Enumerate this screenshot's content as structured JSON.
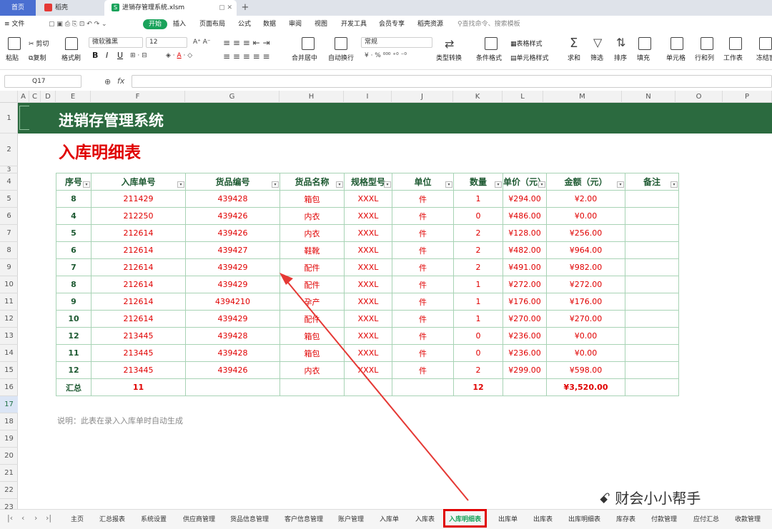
{
  "window": {
    "tabs": [
      {
        "label": "首页"
      },
      {
        "label": "稻壳"
      },
      {
        "label": "进销存管理系统.xlsm"
      }
    ]
  },
  "menu": {
    "file": "文件",
    "items": [
      "开始",
      "插入",
      "页面布局",
      "公式",
      "数据",
      "审阅",
      "视图",
      "开发工具",
      "会员专享",
      "稻壳资源"
    ],
    "search_placeholder": "查找命令、搜索模板"
  },
  "ribbon": {
    "paste": "粘贴",
    "cut": "剪切",
    "copy": "复制",
    "format_painter": "格式刷",
    "font_name": "微软雅黑",
    "font_size": "12",
    "merge": "合并居中",
    "wrap": "自动换行",
    "number_format": "常规",
    "type_convert": "类型转换",
    "cond_format": "条件格式",
    "table_style": "表格样式",
    "cell_style": "单元格样式",
    "sum": "求和",
    "filter": "筛选",
    "sort": "排序",
    "fill": "填充",
    "cell": "单元格",
    "row_col": "行和列",
    "worksheet": "工作表",
    "freeze": "冻结窗"
  },
  "formula_bar": {
    "cell_ref": "Q17",
    "fx": "fx",
    "value": ""
  },
  "columns": [
    "A",
    "C",
    "D",
    "E",
    "F",
    "G",
    "H",
    "I",
    "J",
    "K",
    "L",
    "M",
    "N",
    "O",
    "P"
  ],
  "rows": [
    "1",
    "2",
    "3",
    "4",
    "5",
    "6",
    "7",
    "8",
    "9",
    "10",
    "11",
    "12",
    "13",
    "14",
    "15",
    "16",
    "17",
    "18",
    "19",
    "20",
    "21",
    "22",
    "23"
  ],
  "active_row": "17",
  "sheet": {
    "banner_title": "进销存管理系统",
    "subtitle": "入库明细表",
    "headers": [
      "序号",
      "入库单号",
      "货品编号",
      "货品名称",
      "规格型号",
      "单位",
      "数量",
      "单价（元）",
      "金额（元）",
      "备注"
    ],
    "rows": [
      [
        "8",
        "211429",
        "439428",
        "箱包",
        "XXXL",
        "件",
        "1",
        "¥294.00",
        "¥2.00",
        ""
      ],
      [
        "4",
        "212250",
        "439426",
        "内衣",
        "XXXL",
        "件",
        "0",
        "¥486.00",
        "¥0.00",
        ""
      ],
      [
        "5",
        "212614",
        "439426",
        "内衣",
        "XXXL",
        "件",
        "2",
        "¥128.00",
        "¥256.00",
        ""
      ],
      [
        "6",
        "212614",
        "439427",
        "鞋靴",
        "XXXL",
        "件",
        "2",
        "¥482.00",
        "¥964.00",
        ""
      ],
      [
        "7",
        "212614",
        "439429",
        "配件",
        "XXXL",
        "件",
        "2",
        "¥491.00",
        "¥982.00",
        ""
      ],
      [
        "8",
        "212614",
        "439429",
        "配件",
        "XXXL",
        "件",
        "1",
        "¥272.00",
        "¥272.00",
        ""
      ],
      [
        "9",
        "212614",
        "4394210",
        "孕产",
        "XXXL",
        "件",
        "1",
        "¥176.00",
        "¥176.00",
        ""
      ],
      [
        "10",
        "212614",
        "439429",
        "配件",
        "XXXL",
        "件",
        "1",
        "¥270.00",
        "¥270.00",
        ""
      ],
      [
        "12",
        "213445",
        "439428",
        "箱包",
        "XXXL",
        "件",
        "0",
        "¥236.00",
        "¥0.00",
        ""
      ],
      [
        "11",
        "213445",
        "439428",
        "箱包",
        "XXXL",
        "件",
        "0",
        "¥236.00",
        "¥0.00",
        ""
      ],
      [
        "12",
        "213445",
        "439426",
        "内衣",
        "XXXL",
        "件",
        "2",
        "¥299.00",
        "¥598.00",
        ""
      ]
    ],
    "total": {
      "label": "汇总",
      "count": "11",
      "quantity": "12",
      "amount": "¥3,520.00"
    },
    "note": "说明：此表在录入入库单时自动生成"
  },
  "sheet_tabs": [
    "主页",
    "汇总报表",
    "系统设置",
    "供应商管理",
    "货品信息管理",
    "客户信息管理",
    "账户管理",
    "入库单",
    "入库表",
    "入库明细表",
    "出库单",
    "出库表",
    "出库明细表",
    "库存表",
    "付款管理",
    "应付汇总",
    "收款管理"
  ],
  "active_sheet_tab": "入库明细表",
  "watermark": "财会小小帮手",
  "colors": {
    "banner": "#2b6a3f",
    "red": "#e00000",
    "accent": "#1aa35b"
  }
}
